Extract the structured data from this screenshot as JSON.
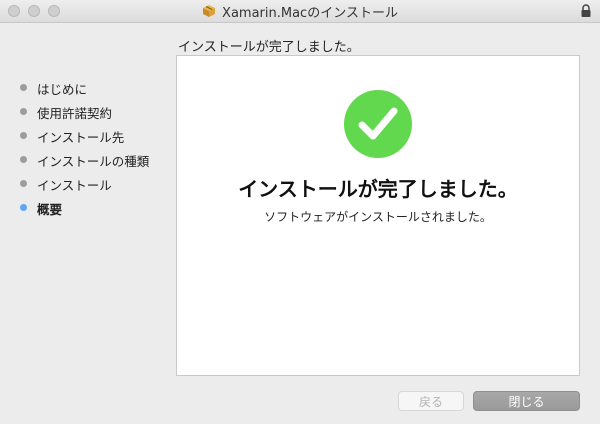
{
  "window": {
    "title": "Xamarin.Macのインストール",
    "title_icon": "package-icon",
    "lock_icon": "lock-icon"
  },
  "heading": "インストールが完了しました。",
  "sidebar": {
    "items": [
      {
        "label": "はじめに",
        "active": false
      },
      {
        "label": "使用許諾契約",
        "active": false
      },
      {
        "label": "インストール先",
        "active": false
      },
      {
        "label": "インストールの種類",
        "active": false
      },
      {
        "label": "インストール",
        "active": false
      },
      {
        "label": "概要",
        "active": true
      }
    ]
  },
  "main": {
    "success_icon": "checkmark-circle-icon",
    "title": "インストールが完了しました。",
    "subtitle": "ソフトウェアがインストールされました。"
  },
  "buttons": {
    "back_label": "戻る",
    "close_label": "閉じる"
  },
  "colors": {
    "success": "#62d84e",
    "active_step": "#5ea5f5",
    "inactive_step": "#9b9b9b",
    "primary_button": "#a0a0a0"
  }
}
